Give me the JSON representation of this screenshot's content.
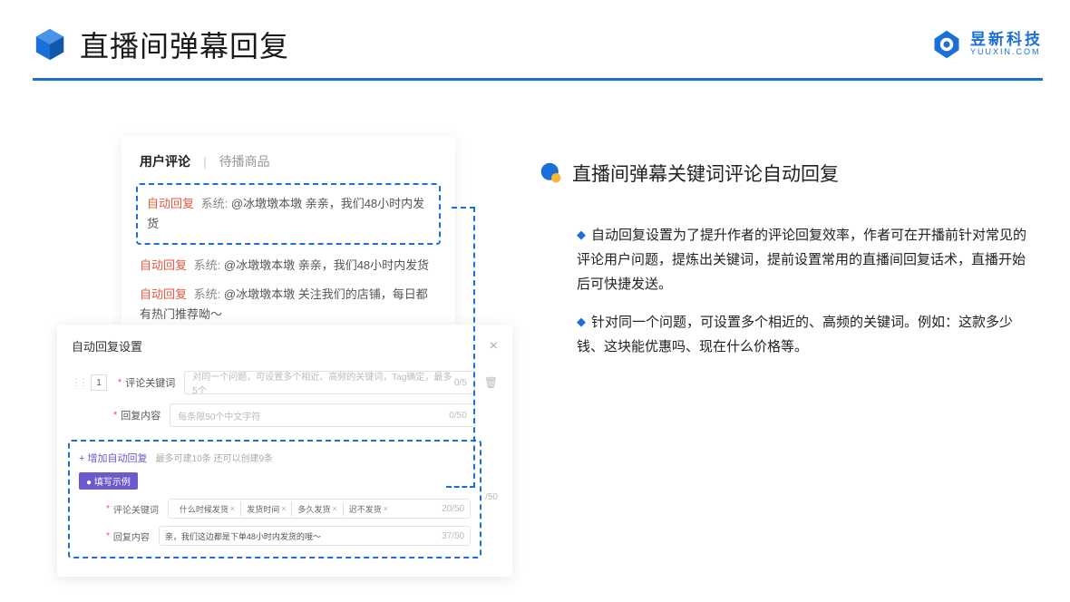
{
  "header": {
    "title": "直播间弹幕回复",
    "logo_cn": "昱新科技",
    "logo_en": "YUUXIN.COM"
  },
  "comments_card": {
    "tabs": {
      "active": "用户评论",
      "inactive": "待播商品"
    },
    "highlight": {
      "tag": "自动回复",
      "sys": "系统:",
      "text": "@冰墩墩本墩 亲亲，我们48小时内发货"
    },
    "items": [
      {
        "tag": "自动回复",
        "sys": "系统:",
        "text": "@冰墩墩本墩 亲亲，我们48小时内发货"
      },
      {
        "tag": "自动回复",
        "sys": "系统:",
        "text": "@冰墩墩本墩 关注我们的店铺，每日都有热门推荐呦～"
      }
    ]
  },
  "settings_card": {
    "title": "自动回复设置",
    "row_number": "1",
    "keyword_label": "评论关键词",
    "keyword_placeholder": "对同一个问题，可设置多个相近、高频的关键词，Tag确定，最多5个",
    "keyword_count": "0/5",
    "content_label": "回复内容",
    "content_placeholder": "每条限50个中文字符",
    "content_count": "0/50",
    "add_label": "+ 增加自动回复",
    "add_tip": "最多可建10条 还可以创建9条",
    "example_badge": "● 填写示例",
    "ex_keyword_label": "评论关键词",
    "ex_tags": [
      "什么时候发货",
      "发货时间",
      "多久发货",
      "迟不发货"
    ],
    "ex_keyword_count": "20/50",
    "ex_content_label": "回复内容",
    "ex_content_text": "亲，我们这边都是下单48小时内发货的哦～",
    "ex_content_count": "37/50",
    "outer_count": "/50"
  },
  "right": {
    "heading": "直播间弹幕关键词评论自动回复",
    "bullets": [
      "自动回复设置为了提升作者的评论回复效率，作者可在开播前针对常见的评论用户问题，提炼出关键词，提前设置常用的直播间回复话术，直播开始后可快捷发送。",
      "针对同一个问题，可设置多个相近的、高频的关键词。例如：这款多少钱、这块能优惠吗、现在什么价格等。"
    ]
  }
}
